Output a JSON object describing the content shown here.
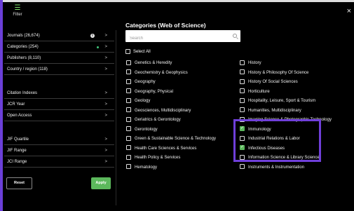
{
  "header": {
    "filter_label": "Filter",
    "close_label": "×"
  },
  "left_panel": {
    "group1": [
      {
        "label": "Journals (26,674)",
        "info": "i",
        "dot": false
      },
      {
        "label": "Categories (254)",
        "dot": true
      },
      {
        "label": "Publishers (8,110)",
        "dot": false
      },
      {
        "label": "Country / region (118)",
        "dot": false
      }
    ],
    "group2": [
      {
        "label": "Citation Indexes"
      },
      {
        "label": "JCR Year"
      },
      {
        "label": "Open Access"
      }
    ],
    "group3": [
      {
        "label": "JIF Quartile"
      },
      {
        "label": "JIF Range"
      },
      {
        "label": "JCI Range"
      }
    ],
    "chevron": ">"
  },
  "buttons": {
    "reset": "Reset",
    "apply": "Apply"
  },
  "categories_panel": {
    "title": "Categories (Web of Science)",
    "search_placeholder": "Search",
    "select_all": "Select All",
    "column_a": [
      {
        "label": "Genetics & Heredity",
        "checked": false
      },
      {
        "label": "Geochemistry & Geophysics",
        "checked": false
      },
      {
        "label": "Geography",
        "checked": false
      },
      {
        "label": "Geography, Physical",
        "checked": false
      },
      {
        "label": "Geology",
        "checked": false
      },
      {
        "label": "Geosciences, Multidisciplinary",
        "checked": false
      },
      {
        "label": "Geriatrics & Gerontology",
        "checked": false
      },
      {
        "label": "Gerontology",
        "checked": false
      },
      {
        "label": "Green & Sustainable Science & Technology",
        "checked": false
      },
      {
        "label": "Health Care Sciences & Services",
        "checked": false
      },
      {
        "label": "Health Policy & Services",
        "checked": false
      },
      {
        "label": "Hematology",
        "checked": false
      }
    ],
    "column_b": [
      {
        "label": "History",
        "checked": false
      },
      {
        "label": "History & Philosophy Of Science",
        "checked": false
      },
      {
        "label": "History Of Social Sciences",
        "checked": false
      },
      {
        "label": "Horticulture",
        "checked": false
      },
      {
        "label": "Hospitality, Leisure, Sport & Tourism",
        "checked": false
      },
      {
        "label": "Humanities, Multidisciplinary",
        "checked": false
      },
      {
        "label": "Imaging Science & Photographic Technology",
        "checked": false
      },
      {
        "label": "Immunology",
        "checked": true
      },
      {
        "label": "Industrial Relations & Labor",
        "checked": false
      },
      {
        "label": "Infectious Diseases",
        "checked": true
      },
      {
        "label": "Information Science & Library Science",
        "checked": false
      },
      {
        "label": "Instruments & Instrumentation",
        "checked": false
      }
    ]
  },
  "colors": {
    "accent_green": "#5cb85c",
    "highlight_purple": "#6f3fd9",
    "background": "#000000"
  }
}
